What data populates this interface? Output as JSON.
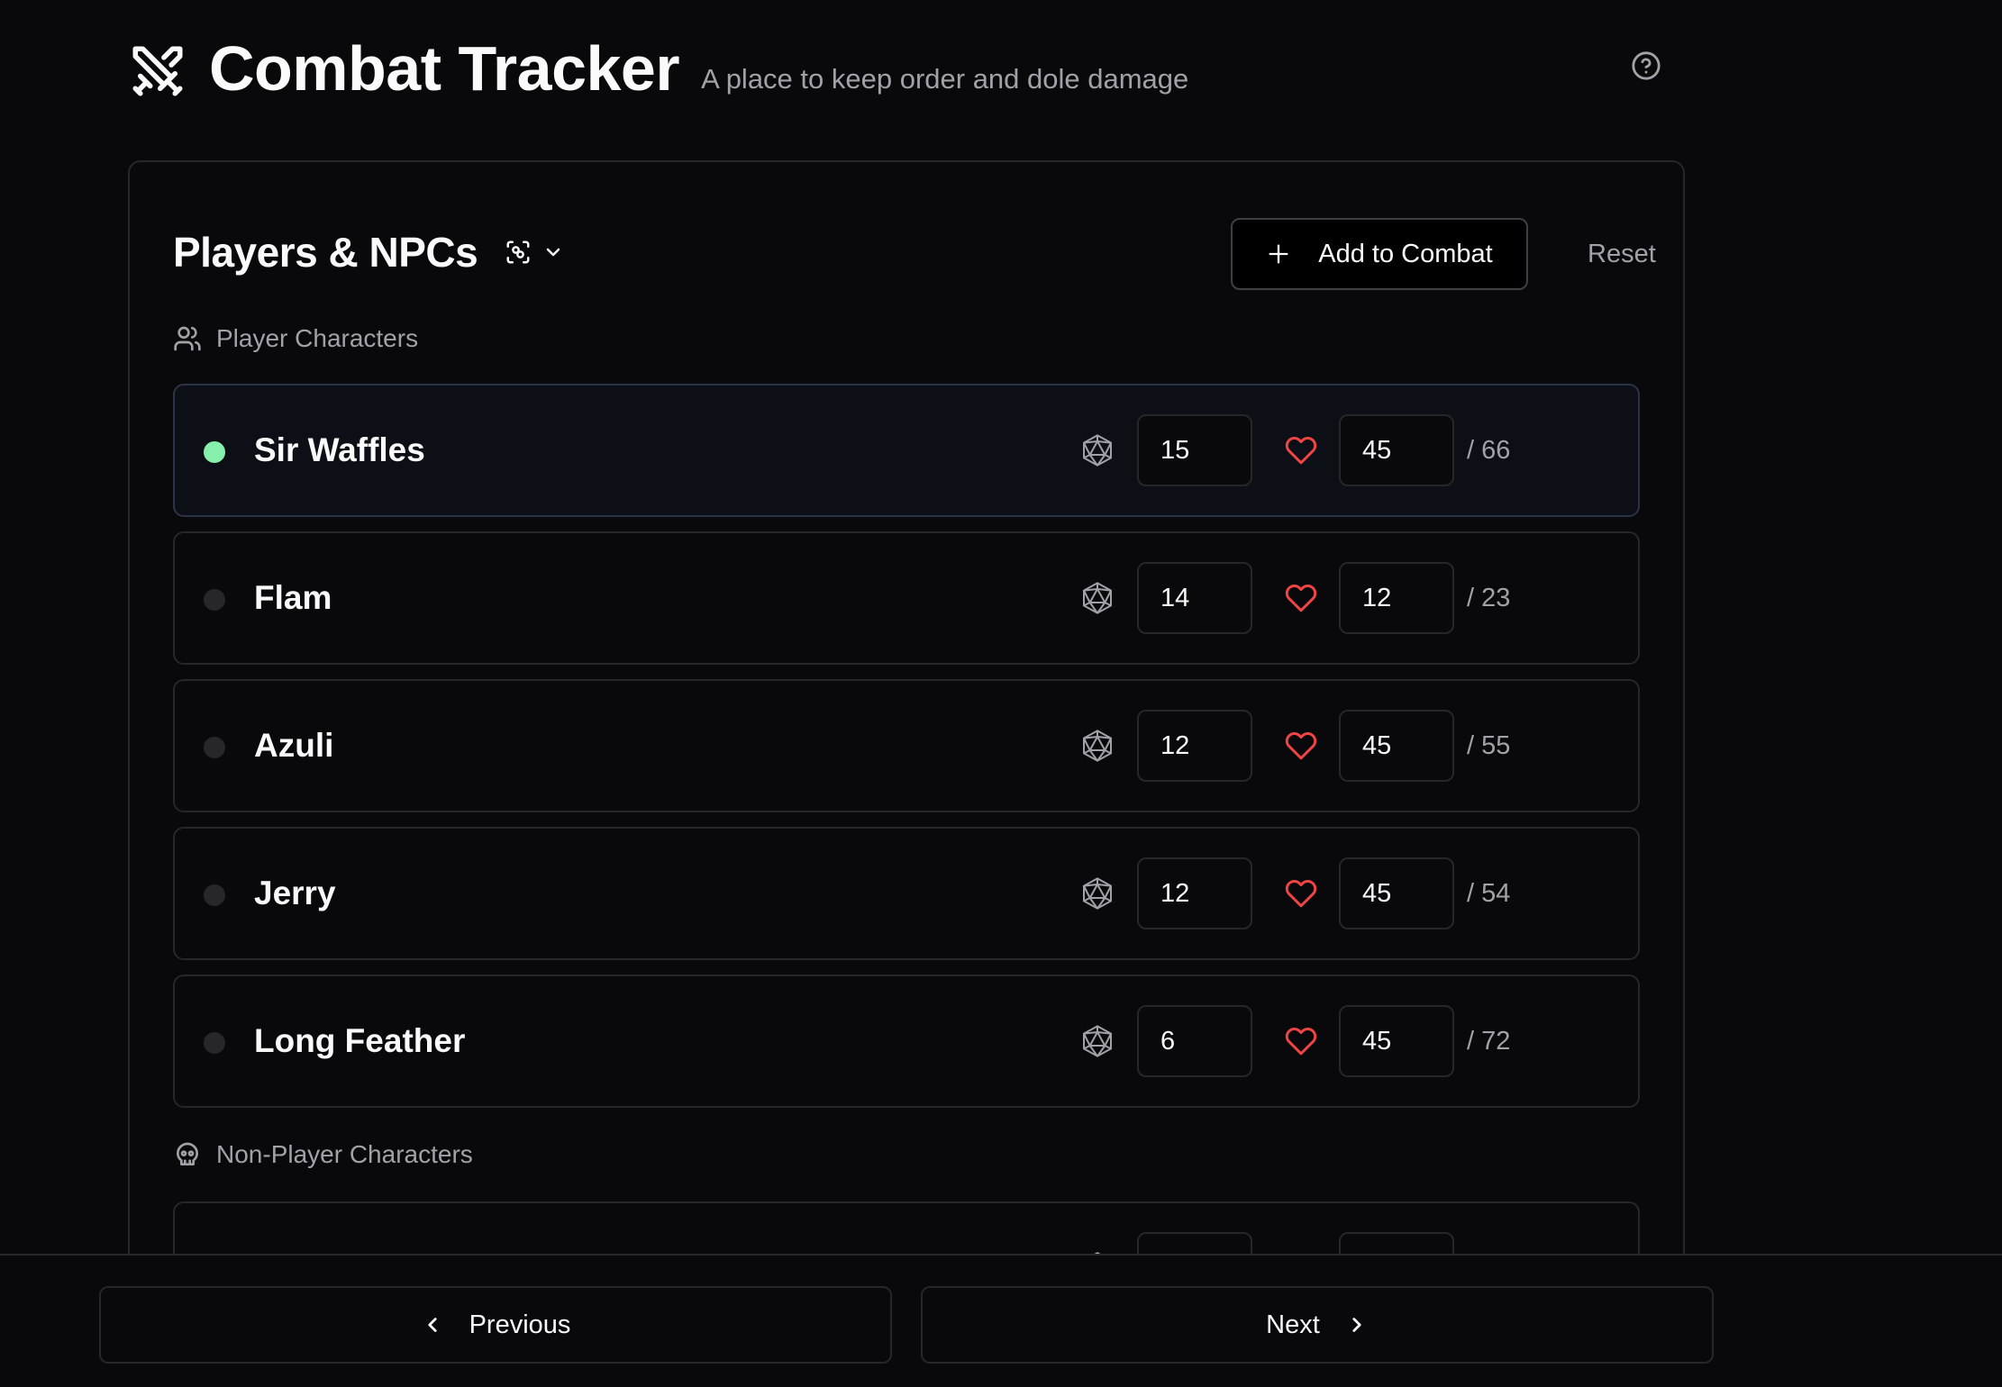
{
  "header": {
    "title": "Combat Tracker",
    "subtitle": "A place to keep order and dole damage",
    "logo_icon": "crossed-swords-icon",
    "help_icon": "help-circle-icon"
  },
  "card": {
    "title": "Players & NPCs",
    "view_toggle_icon": "scan-icon",
    "add_button_label": "Add to Combat",
    "reset_button_label": "Reset",
    "player_section_label": "Player Characters",
    "npc_section_label": "Non-Player Characters",
    "players": [
      {
        "name": "Sir Waffles",
        "initiative": "15",
        "hp": "45",
        "max_hp": "/ 66",
        "active": true
      },
      {
        "name": "Flam",
        "initiative": "14",
        "hp": "12",
        "max_hp": "/ 23",
        "active": false
      },
      {
        "name": "Azuli",
        "initiative": "12",
        "hp": "45",
        "max_hp": "/ 55",
        "active": false
      },
      {
        "name": "Jerry",
        "initiative": "12",
        "hp": "45",
        "max_hp": "/ 54",
        "active": false
      },
      {
        "name": "Long Feather",
        "initiative": "6",
        "hp": "45",
        "max_hp": "/ 72",
        "active": false
      }
    ]
  },
  "footer": {
    "previous_label": "Previous",
    "next_label": "Next"
  },
  "colors": {
    "background": "#09090b",
    "border": "#27272a",
    "active_dot": "#86efac",
    "heart": "#ef4444",
    "muted_text": "#a1a1aa"
  }
}
